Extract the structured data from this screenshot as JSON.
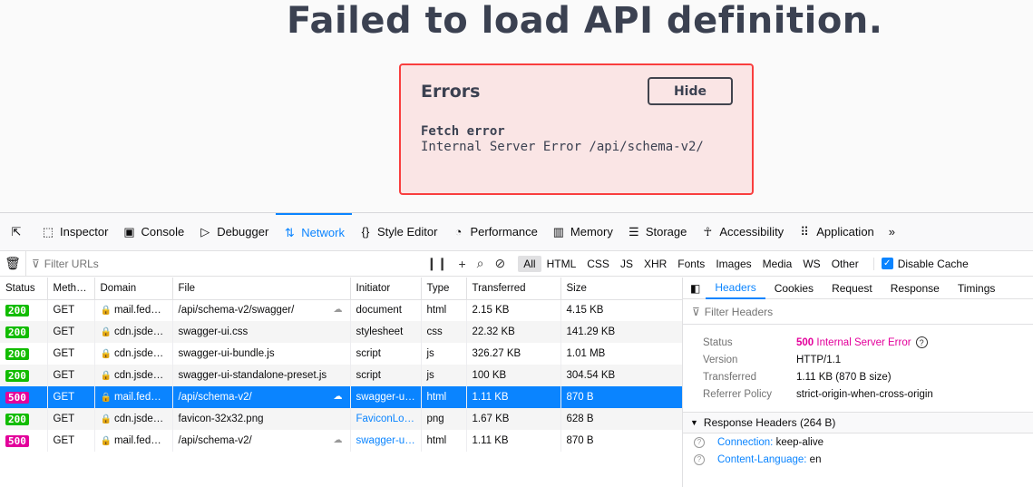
{
  "page": {
    "title": "Failed to load API definition.",
    "errors": {
      "heading": "Errors",
      "hide_label": "Hide",
      "subheading": "Fetch error",
      "message": "Internal Server Error /api/schema-v2/"
    }
  },
  "devtools": {
    "tabs": [
      {
        "label": "Inspector",
        "icon": "inspector-icon"
      },
      {
        "label": "Console",
        "icon": "console-icon"
      },
      {
        "label": "Debugger",
        "icon": "debugger-icon"
      },
      {
        "label": "Network",
        "icon": "network-icon",
        "active": true
      },
      {
        "label": "Style Editor",
        "icon": "style-editor-icon"
      },
      {
        "label": "Performance",
        "icon": "performance-icon"
      },
      {
        "label": "Memory",
        "icon": "memory-icon"
      },
      {
        "label": "Storage",
        "icon": "storage-icon"
      },
      {
        "label": "Accessibility",
        "icon": "accessibility-icon"
      },
      {
        "label": "Application",
        "icon": "application-icon"
      }
    ],
    "filter_placeholder": "Filter URLs",
    "type_filters": [
      "All",
      "HTML",
      "CSS",
      "JS",
      "XHR",
      "Fonts",
      "Images",
      "Media",
      "WS",
      "Other"
    ],
    "disable_cache_label": "Disable Cache",
    "columns": [
      "Status",
      "Meth…",
      "Domain",
      "File",
      "Initiator",
      "Type",
      "Transferred",
      "Size"
    ],
    "requests": [
      {
        "status": "200",
        "method": "GET",
        "domain": "mail.fed…",
        "file": "/api/schema-v2/swagger/",
        "initiator": "document",
        "type": "html",
        "transferred": "2.15 KB",
        "size": "4.15 KB"
      },
      {
        "status": "200",
        "method": "GET",
        "domain": "cdn.jsde…",
        "file": "swagger-ui.css",
        "initiator": "stylesheet",
        "type": "css",
        "transferred": "22.32 KB",
        "size": "141.29 KB"
      },
      {
        "status": "200",
        "method": "GET",
        "domain": "cdn.jsde…",
        "file": "swagger-ui-bundle.js",
        "initiator": "script",
        "type": "js",
        "transferred": "326.27 KB",
        "size": "1.01 MB"
      },
      {
        "status": "200",
        "method": "GET",
        "domain": "cdn.jsde…",
        "file": "swagger-ui-standalone-preset.js",
        "initiator": "script",
        "type": "js",
        "transferred": "100 KB",
        "size": "304.54 KB"
      },
      {
        "status": "500",
        "method": "GET",
        "domain": "mail.fed…",
        "file": "/api/schema-v2/",
        "initiator": "swagger-u…",
        "type": "html",
        "transferred": "1.11 KB",
        "size": "870 B"
      },
      {
        "status": "200",
        "method": "GET",
        "domain": "cdn.jsde…",
        "file": "favicon-32x32.png",
        "initiator": "FaviconLo…",
        "type": "png",
        "transferred": "1.67 KB",
        "size": "628 B"
      },
      {
        "status": "500",
        "method": "GET",
        "domain": "mail.fed…",
        "file": "/api/schema-v2/",
        "initiator": "swagger-u…",
        "type": "html",
        "transferred": "1.11 KB",
        "size": "870 B"
      }
    ],
    "side_tabs": [
      "Headers",
      "Cookies",
      "Request",
      "Response",
      "Timings"
    ],
    "filter_headers_placeholder": "Filter Headers",
    "summary": {
      "status_key": "Status",
      "status_code": "500",
      "status_text": "Internal Server Error",
      "version_key": "Version",
      "version": "HTTP/1.1",
      "transferred_key": "Transferred",
      "transferred": "1.11 KB (870 B size)",
      "referrer_key": "Referrer Policy",
      "referrer": "strict-origin-when-cross-origin"
    },
    "response_headers_label": "Response Headers (264 B)",
    "response_headers": [
      {
        "name": "Connection:",
        "value": "keep-alive"
      },
      {
        "name": "Content-Language:",
        "value": "en"
      }
    ]
  }
}
